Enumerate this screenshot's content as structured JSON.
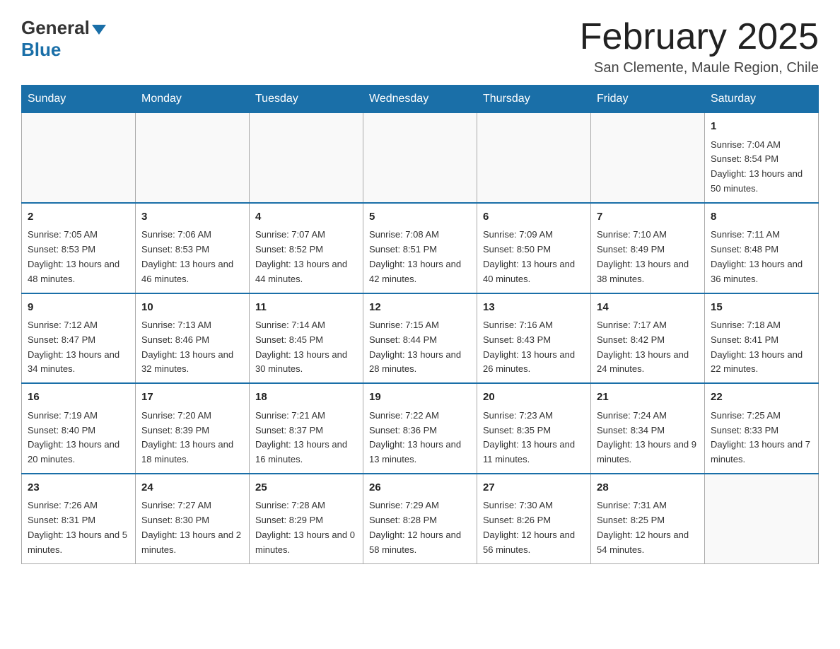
{
  "header": {
    "logo_general": "General",
    "logo_blue": "Blue",
    "title": "February 2025",
    "subtitle": "San Clemente, Maule Region, Chile"
  },
  "days_of_week": [
    "Sunday",
    "Monday",
    "Tuesday",
    "Wednesday",
    "Thursday",
    "Friday",
    "Saturday"
  ],
  "weeks": [
    [
      {
        "day": "",
        "info": ""
      },
      {
        "day": "",
        "info": ""
      },
      {
        "day": "",
        "info": ""
      },
      {
        "day": "",
        "info": ""
      },
      {
        "day": "",
        "info": ""
      },
      {
        "day": "",
        "info": ""
      },
      {
        "day": "1",
        "info": "Sunrise: 7:04 AM\nSunset: 8:54 PM\nDaylight: 13 hours and 50 minutes."
      }
    ],
    [
      {
        "day": "2",
        "info": "Sunrise: 7:05 AM\nSunset: 8:53 PM\nDaylight: 13 hours and 48 minutes."
      },
      {
        "day": "3",
        "info": "Sunrise: 7:06 AM\nSunset: 8:53 PM\nDaylight: 13 hours and 46 minutes."
      },
      {
        "day": "4",
        "info": "Sunrise: 7:07 AM\nSunset: 8:52 PM\nDaylight: 13 hours and 44 minutes."
      },
      {
        "day": "5",
        "info": "Sunrise: 7:08 AM\nSunset: 8:51 PM\nDaylight: 13 hours and 42 minutes."
      },
      {
        "day": "6",
        "info": "Sunrise: 7:09 AM\nSunset: 8:50 PM\nDaylight: 13 hours and 40 minutes."
      },
      {
        "day": "7",
        "info": "Sunrise: 7:10 AM\nSunset: 8:49 PM\nDaylight: 13 hours and 38 minutes."
      },
      {
        "day": "8",
        "info": "Sunrise: 7:11 AM\nSunset: 8:48 PM\nDaylight: 13 hours and 36 minutes."
      }
    ],
    [
      {
        "day": "9",
        "info": "Sunrise: 7:12 AM\nSunset: 8:47 PM\nDaylight: 13 hours and 34 minutes."
      },
      {
        "day": "10",
        "info": "Sunrise: 7:13 AM\nSunset: 8:46 PM\nDaylight: 13 hours and 32 minutes."
      },
      {
        "day": "11",
        "info": "Sunrise: 7:14 AM\nSunset: 8:45 PM\nDaylight: 13 hours and 30 minutes."
      },
      {
        "day": "12",
        "info": "Sunrise: 7:15 AM\nSunset: 8:44 PM\nDaylight: 13 hours and 28 minutes."
      },
      {
        "day": "13",
        "info": "Sunrise: 7:16 AM\nSunset: 8:43 PM\nDaylight: 13 hours and 26 minutes."
      },
      {
        "day": "14",
        "info": "Sunrise: 7:17 AM\nSunset: 8:42 PM\nDaylight: 13 hours and 24 minutes."
      },
      {
        "day": "15",
        "info": "Sunrise: 7:18 AM\nSunset: 8:41 PM\nDaylight: 13 hours and 22 minutes."
      }
    ],
    [
      {
        "day": "16",
        "info": "Sunrise: 7:19 AM\nSunset: 8:40 PM\nDaylight: 13 hours and 20 minutes."
      },
      {
        "day": "17",
        "info": "Sunrise: 7:20 AM\nSunset: 8:39 PM\nDaylight: 13 hours and 18 minutes."
      },
      {
        "day": "18",
        "info": "Sunrise: 7:21 AM\nSunset: 8:37 PM\nDaylight: 13 hours and 16 minutes."
      },
      {
        "day": "19",
        "info": "Sunrise: 7:22 AM\nSunset: 8:36 PM\nDaylight: 13 hours and 13 minutes."
      },
      {
        "day": "20",
        "info": "Sunrise: 7:23 AM\nSunset: 8:35 PM\nDaylight: 13 hours and 11 minutes."
      },
      {
        "day": "21",
        "info": "Sunrise: 7:24 AM\nSunset: 8:34 PM\nDaylight: 13 hours and 9 minutes."
      },
      {
        "day": "22",
        "info": "Sunrise: 7:25 AM\nSunset: 8:33 PM\nDaylight: 13 hours and 7 minutes."
      }
    ],
    [
      {
        "day": "23",
        "info": "Sunrise: 7:26 AM\nSunset: 8:31 PM\nDaylight: 13 hours and 5 minutes."
      },
      {
        "day": "24",
        "info": "Sunrise: 7:27 AM\nSunset: 8:30 PM\nDaylight: 13 hours and 2 minutes."
      },
      {
        "day": "25",
        "info": "Sunrise: 7:28 AM\nSunset: 8:29 PM\nDaylight: 13 hours and 0 minutes."
      },
      {
        "day": "26",
        "info": "Sunrise: 7:29 AM\nSunset: 8:28 PM\nDaylight: 12 hours and 58 minutes."
      },
      {
        "day": "27",
        "info": "Sunrise: 7:30 AM\nSunset: 8:26 PM\nDaylight: 12 hours and 56 minutes."
      },
      {
        "day": "28",
        "info": "Sunrise: 7:31 AM\nSunset: 8:25 PM\nDaylight: 12 hours and 54 minutes."
      },
      {
        "day": "",
        "info": ""
      }
    ]
  ]
}
